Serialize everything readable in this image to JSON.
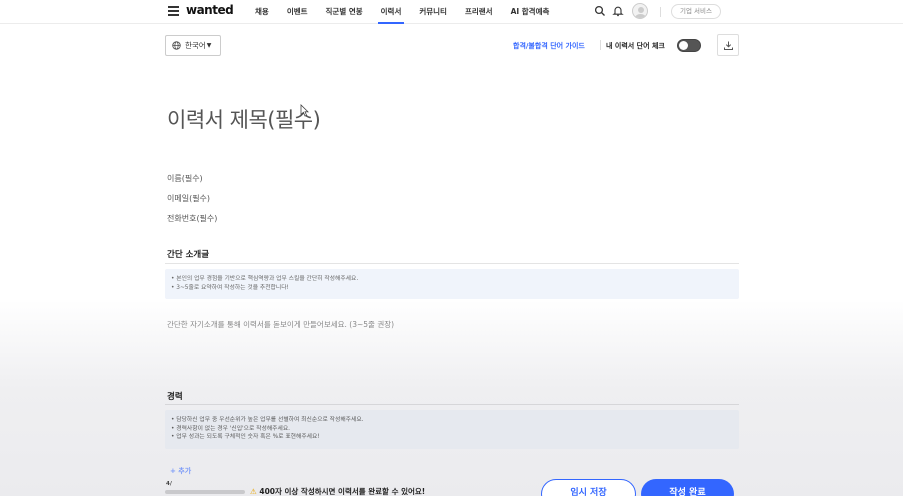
{
  "nav": {
    "logo": "wanted",
    "items": [
      {
        "label": "채용",
        "active": false
      },
      {
        "label": "이벤트",
        "active": false
      },
      {
        "label": "직군별 연봉",
        "active": false
      },
      {
        "label": "이력서",
        "active": true
      },
      {
        "label": "커뮤니티",
        "active": false
      },
      {
        "label": "프리랜서",
        "active": false
      },
      {
        "label": "AI 합격예측",
        "active": false
      }
    ],
    "corp_button": "기업 서비스"
  },
  "toolbar": {
    "language": "한국어",
    "guide_link": "합격/불합격 단어 가이드",
    "check_label": "내 이력서 단어 체크"
  },
  "resume": {
    "title_placeholder": "이력서 제목(필수)",
    "name_placeholder": "이름(필수)",
    "email_placeholder": "이메일(필수)",
    "phone_placeholder": "전화번호(필수)"
  },
  "intro": {
    "title": "간단 소개글",
    "guide": [
      "• 본인의 업무 경험을 기반으로 핵심역량과 업무 스킬을 간단히 작성해주세요.",
      "• 3~5줄로 요약하여 작성하는 것을 추천합니다!"
    ],
    "placeholder": "간단한 자기소개를 통해 이력서를 돋보이게 만들어보세요. (3~5줄 권장)"
  },
  "career": {
    "title": "경력",
    "guide": [
      "• 담당하신 업무 중 우선순위가 높은 업무를 선별하여 최신순으로 작성해주세요.",
      "• 경력사항이 없는 경우 '신입'으로 작성해주세요.",
      "• 업무 성과는 되도록 구체적인 숫자 혹은 %로 표현해주세요!"
    ],
    "add_label": "+ 추가"
  },
  "footer": {
    "progress_value": "4/",
    "progress_fraction": 0.0,
    "hint": "400자 이상 작성하시면 이력서를 완료할 수 있어요!",
    "save_button": "임시 저장",
    "done_button": "작성 완료"
  },
  "colors": {
    "accent": "#3366ff",
    "guide_bg": "#f0f4fb"
  }
}
